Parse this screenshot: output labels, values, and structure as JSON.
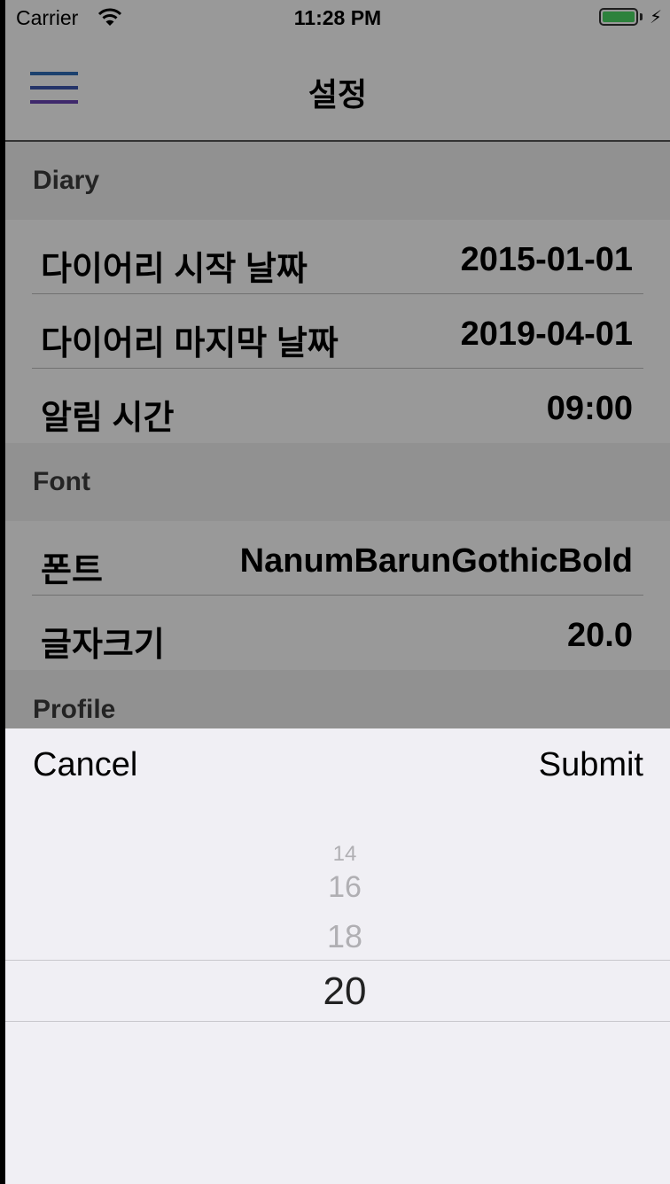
{
  "status_bar": {
    "carrier": "Carrier",
    "time": "11:28 PM"
  },
  "nav": {
    "title": "설정"
  },
  "sections": {
    "diary": {
      "header": "Diary",
      "rows": [
        {
          "label": "다이어리 시작 날짜",
          "value": "2015-01-01"
        },
        {
          "label": "다이어리 마지막 날짜",
          "value": "2019-04-01"
        },
        {
          "label": "알림 시간",
          "value": "09:00"
        }
      ]
    },
    "font": {
      "header": "Font",
      "rows": [
        {
          "label": "폰트",
          "value": "NanumBarunGothicBold"
        },
        {
          "label": "글자크기",
          "value": "20.0"
        }
      ]
    },
    "profile": {
      "header": "Profile"
    }
  },
  "picker": {
    "cancel_label": "Cancel",
    "submit_label": "Submit",
    "options": [
      "14",
      "16",
      "18",
      "20"
    ],
    "selected": "20"
  },
  "colors": {
    "battery": "#4cd964",
    "hamburger_top": "#2f6db8",
    "hamburger_mid": "#3f58b0",
    "hamburger_bottom": "#6a45b5",
    "overlay": "rgba(0,0,0,0.4)",
    "sheet_background": "#f0eff4"
  }
}
